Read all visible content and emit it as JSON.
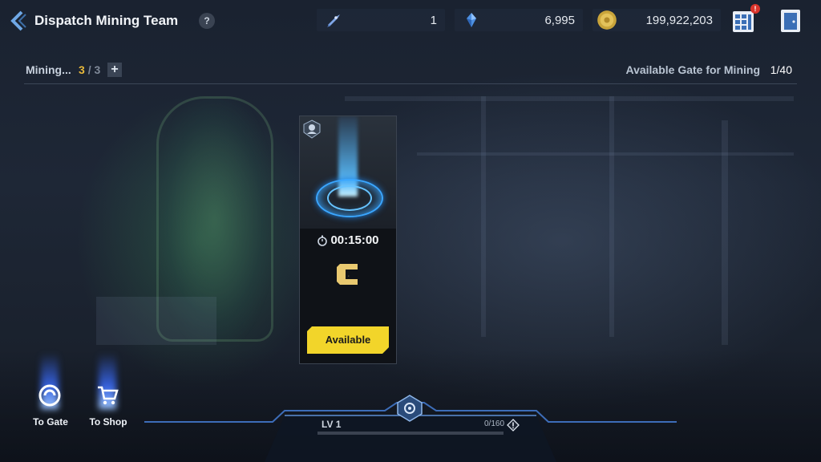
{
  "header": {
    "title": "Dispatch Mining Team",
    "help_label": "?"
  },
  "resources": [
    {
      "icon": "rocket-icon",
      "value": "1"
    },
    {
      "icon": "crystal-icon",
      "value": "6,995"
    },
    {
      "icon": "gold-coin-icon",
      "value": "199,922,203"
    }
  ],
  "top_buttons": {
    "menu_notification": "!"
  },
  "mining": {
    "label": "Mining...",
    "current": "3",
    "separator": "/",
    "max": "3",
    "add_label": "+"
  },
  "gate": {
    "label": "Available Gate for Mining",
    "value": "1/40"
  },
  "card": {
    "timer": "00:15:00",
    "grade": "C",
    "button_label": "Available"
  },
  "shortcuts": [
    {
      "label": "To Gate",
      "icon": "gate-swirl-icon"
    },
    {
      "label": "To Shop",
      "icon": "shopping-cart-icon"
    }
  ],
  "level": {
    "label": "LV 1",
    "xp_text": "0/160",
    "xp_progress": 0.0
  },
  "colors": {
    "accent_yellow": "#f2d52a",
    "gold_count": "#e8b93a",
    "beam_blue": "#3aa6ff",
    "notification_red": "#d9342b"
  }
}
